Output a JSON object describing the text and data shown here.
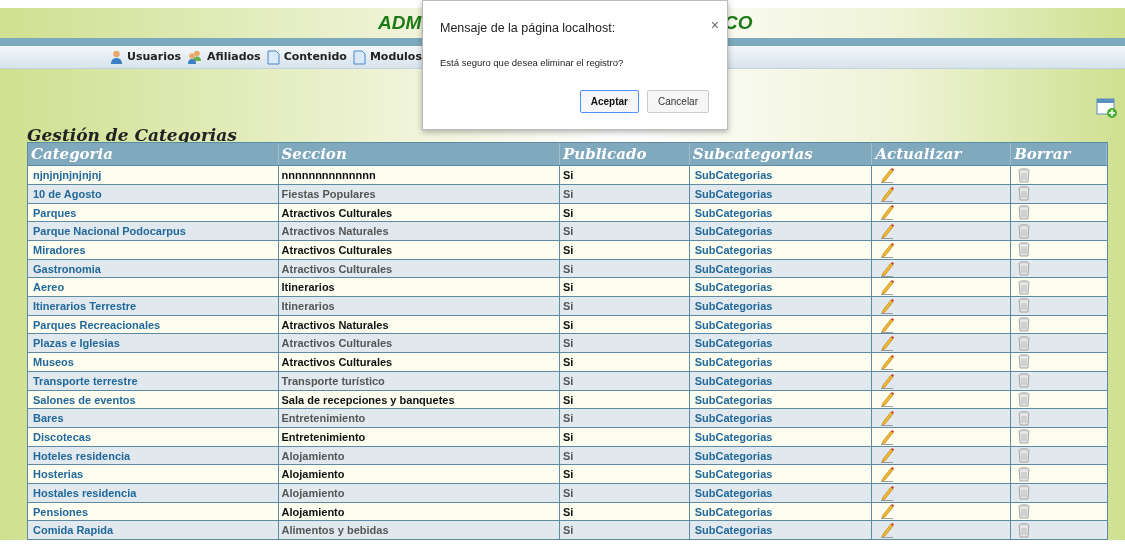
{
  "header": {
    "title_left": "ADM",
    "title_right": "CO"
  },
  "menu": [
    {
      "label": "Usuarios",
      "kind": "user"
    },
    {
      "label": "Afiliados",
      "kind": "group"
    },
    {
      "label": "Contenido",
      "kind": "page"
    },
    {
      "label": "Modulos",
      "kind": "page"
    }
  ],
  "heading": "Gestión de Categorias",
  "table": {
    "columns": [
      "Categoria",
      "Seccion",
      "Publicado",
      "Subcategorias",
      "Actualizar",
      "Borrar"
    ],
    "rows": [
      {
        "categoria": "njnjnjnjnjnjnj",
        "seccion": "nnnnnnnnnnnnnn",
        "publicado": "Si",
        "link": "SubCategorias"
      },
      {
        "categoria": "10 de Agosto",
        "seccion": "Fiestas Populares",
        "publicado": "Si",
        "link": "SubCategorias"
      },
      {
        "categoria": "Parques",
        "seccion": "Atractivos Culturales",
        "publicado": "Si",
        "link": "SubCategorias"
      },
      {
        "categoria": "Parque Nacional Podocarpus",
        "seccion": "Atractivos Naturales",
        "publicado": "Si",
        "link": "SubCategorias"
      },
      {
        "categoria": "Miradores",
        "seccion": "Atractivos Culturales",
        "publicado": "Si",
        "link": "SubCategorias"
      },
      {
        "categoria": "Gastronomia",
        "seccion": "Atractivos Culturales",
        "publicado": "Si",
        "link": "SubCategorias"
      },
      {
        "categoria": "Aereo",
        "seccion": "Itinerarios",
        "publicado": "Si",
        "link": "SubCategorias"
      },
      {
        "categoria": "Itinerarios Terrestre",
        "seccion": "Itinerarios",
        "publicado": "Si",
        "link": "SubCategorias"
      },
      {
        "categoria": "Parques Recreacionales",
        "seccion": "Atractivos Naturales",
        "publicado": "Si",
        "link": "SubCategorias"
      },
      {
        "categoria": "Plazas e Iglesias",
        "seccion": "Atractivos Culturales",
        "publicado": "Si",
        "link": "SubCategorias"
      },
      {
        "categoria": "Museos",
        "seccion": "Atractivos Culturales",
        "publicado": "Si",
        "link": "SubCategorias"
      },
      {
        "categoria": "Transporte terrestre",
        "seccion": "Transporte turístico",
        "publicado": "Si",
        "link": "SubCategorias"
      },
      {
        "categoria": "Salones de eventos",
        "seccion": "Sala de recepciones y banquetes",
        "publicado": "Si",
        "link": "SubCategorias"
      },
      {
        "categoria": "Bares",
        "seccion": "Entretenimiento",
        "publicado": "Si",
        "link": "SubCategorias"
      },
      {
        "categoria": "Discotecas",
        "seccion": "Entretenimiento",
        "publicado": "Si",
        "link": "SubCategorias"
      },
      {
        "categoria": "Hoteles residencia",
        "seccion": "Alojamiento",
        "publicado": "Si",
        "link": "SubCategorias"
      },
      {
        "categoria": "Hosterias",
        "seccion": "Alojamiento",
        "publicado": "Si",
        "link": "SubCategorias"
      },
      {
        "categoria": "Hostales residencia",
        "seccion": "Alojamiento",
        "publicado": "Si",
        "link": "SubCategorias"
      },
      {
        "categoria": "Pensiones",
        "seccion": "Alojamiento",
        "publicado": "Si",
        "link": "SubCategorias"
      },
      {
        "categoria": "Comida Rapida",
        "seccion": "Alimentos y bebidas",
        "publicado": "Si",
        "link": "SubCategorias"
      }
    ]
  },
  "dialog": {
    "title": "Mensaje de la página localhost:",
    "close": "×",
    "message": "Está seguro que desea eliminar el registro?",
    "buttons": [
      {
        "label": "Aceptar",
        "selected": true
      },
      {
        "label": "Cancelar",
        "selected": false
      }
    ]
  }
}
